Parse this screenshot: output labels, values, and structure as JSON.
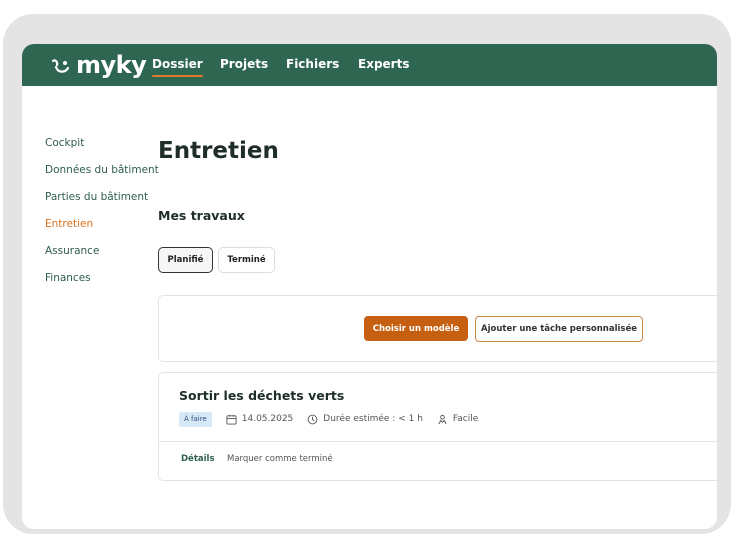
{
  "brand": {
    "logo_text": "myky",
    "color": "#2f6652",
    "accent": "#e07a2a"
  },
  "nav": {
    "items": [
      {
        "label": "Dossier",
        "active": true
      },
      {
        "label": "Projets",
        "active": false
      },
      {
        "label": "Fichiers",
        "active": false
      },
      {
        "label": "Experts",
        "active": false
      }
    ]
  },
  "sidebar": {
    "items": [
      {
        "label": "Cockpit"
      },
      {
        "label": "Données du bâtiment"
      },
      {
        "label": "Parties du bâtiment"
      },
      {
        "label": "Entretien",
        "active": true
      },
      {
        "label": "Assurance"
      },
      {
        "label": "Finances"
      }
    ]
  },
  "page": {
    "title": "Entretien",
    "section_title": "Mes travaux"
  },
  "tabs": [
    {
      "label": "Planifié",
      "selected": true
    },
    {
      "label": "Terminé",
      "selected": false
    }
  ],
  "actions": {
    "primary_label": "Choisir un modèle",
    "secondary_label": "Ajouter une tâche personnalisée"
  },
  "task": {
    "title": "Sortir les déchets verts",
    "status": "À faire",
    "date": "14.05.2025",
    "duration": "Durée estimée : < 1 h",
    "difficulty": "Facile",
    "details_label": "Détails",
    "complete_label": "Marquer comme terminé",
    "icons": {
      "date": "calendar-icon",
      "duration": "clock-icon",
      "difficulty": "person-icon"
    }
  }
}
